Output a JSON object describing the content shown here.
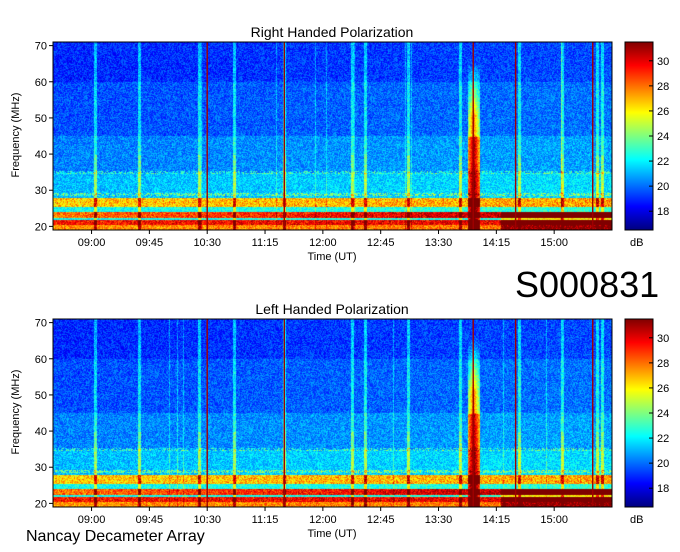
{
  "observation_id": "S000831",
  "footer_text": "Nancay Decameter Array",
  "colormap": [
    "#00007f",
    "#0000ff",
    "#007fff",
    "#00ffff",
    "#7fff7f",
    "#ffff00",
    "#ff7f00",
    "#ff0000",
    "#7f0000"
  ],
  "chart_data": [
    {
      "type": "heatmap",
      "title": "Right Handed Polarization",
      "xlabel": "Time (UT)",
      "ylabel": "Frequency (MHz)",
      "x_tick_labels": [
        "09:00",
        "09:45",
        "10:30",
        "11:15",
        "12:00",
        "12:45",
        "13:30",
        "14:15",
        "15:00"
      ],
      "x_range_hours": [
        8.5,
        15.75
      ],
      "ylim": [
        19,
        71
      ],
      "y_ticks": [
        20,
        30,
        40,
        50,
        60,
        70
      ],
      "colorbar": {
        "label": "dB",
        "range": [
          16.5,
          31.5
        ],
        "ticks": [
          18,
          20,
          22,
          24,
          26,
          28,
          30
        ]
      },
      "burst_time_hours": 13.95,
      "red_marker_times_hours": [
        10.5,
        11.5,
        13.95,
        14.5,
        15.5
      ]
    },
    {
      "type": "heatmap",
      "title": "Left Handed Polarization",
      "xlabel": "Time (UT)",
      "ylabel": "Frequency (MHz)",
      "x_tick_labels": [
        "09:00",
        "09:45",
        "10:30",
        "11:15",
        "12:00",
        "12:45",
        "13:30",
        "14:15",
        "15:00"
      ],
      "x_range_hours": [
        8.5,
        15.75
      ],
      "ylim": [
        19,
        71
      ],
      "y_ticks": [
        20,
        30,
        40,
        50,
        60,
        70
      ],
      "colorbar": {
        "label": "dB",
        "range": [
          16.5,
          31.5
        ],
        "ticks": [
          18,
          20,
          22,
          24,
          26,
          28,
          30
        ]
      },
      "burst_time_hours": 13.95,
      "red_marker_times_hours": [
        10.5,
        11.5,
        13.95,
        14.5,
        15.5
      ]
    }
  ]
}
